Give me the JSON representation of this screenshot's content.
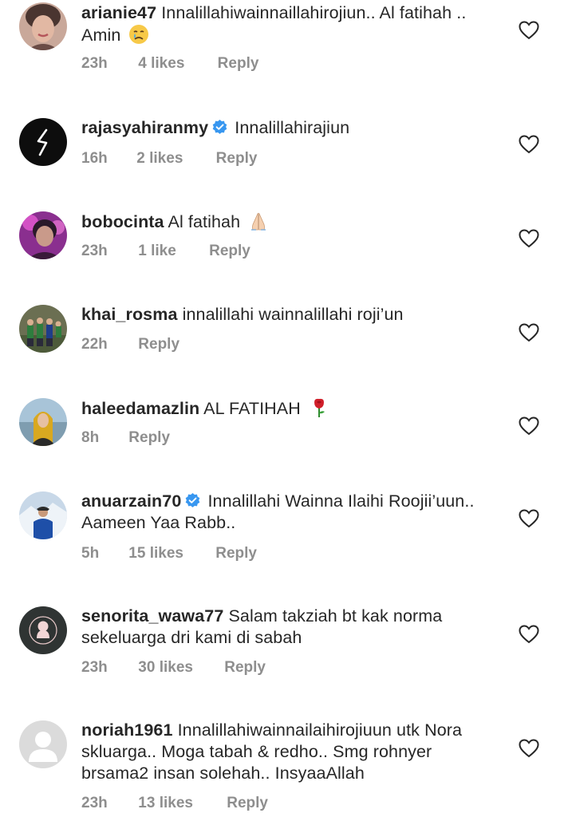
{
  "comments": [
    {
      "username": "arianie47",
      "verified": false,
      "text": "Innalillahiwainnaillahirojiun.. Al fatihah .. Amin",
      "emoji": "crying-face",
      "time": "23h",
      "likes": "4 likes",
      "reply": "Reply",
      "avatar": "woman-portrait"
    },
    {
      "username": "rajasyahiranmy",
      "verified": true,
      "text": "Innalillahirajiun",
      "emoji": "",
      "time": "16h",
      "likes": "2 likes",
      "reply": "Reply",
      "avatar": "logo-s-black"
    },
    {
      "username": "bobocinta",
      "verified": false,
      "text": "Al fatihah",
      "emoji": "folded-hands",
      "time": "23h",
      "likes": "1 like",
      "reply": "Reply",
      "avatar": "woman-pink-light"
    },
    {
      "username": "khai_rosma",
      "verified": false,
      "text": "innalillahi wainnalillahi roji’un",
      "emoji": "",
      "time": "22h",
      "likes": "",
      "reply": "Reply",
      "avatar": "family-group"
    },
    {
      "username": "haleedamazlin",
      "verified": false,
      "text": "AL FATIHAH",
      "emoji": "rose",
      "time": "8h",
      "likes": "",
      "reply": "Reply",
      "avatar": "woman-hijab-yellow"
    },
    {
      "username": "anuarzain70",
      "verified": true,
      "text": "Innalillahi Wainna Ilaihi Roojii’uun.. Aameen Yaa Rabb..",
      "emoji": "",
      "time": "5h",
      "likes": "15 likes",
      "reply": "Reply",
      "avatar": "man-snow"
    },
    {
      "username": "senorita_wawa77",
      "verified": false,
      "text": "Salam takziah bt kak norma sekeluarga dri kami di sabah",
      "emoji": "",
      "time": "23h",
      "likes": "30 likes",
      "reply": "Reply",
      "avatar": "silhouette-pink"
    },
    {
      "username": "noriah1961",
      "verified": false,
      "text": "Innalillahiwainnailaihirojiuun utk Nora skluarga.. Moga tabah & redho.. Smg rohnyer brsama2 insan solehah.. InsyaaAllah",
      "emoji": "",
      "time": "23h",
      "likes": "13 likes",
      "reply": "Reply",
      "avatar": "default-person"
    }
  ],
  "colors": {
    "text": "#262626",
    "meta": "#8e8e8e",
    "verified": "#3897f0"
  }
}
